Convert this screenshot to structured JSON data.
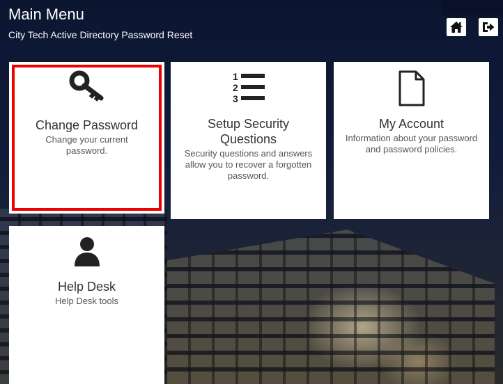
{
  "header": {
    "title": "Main Menu",
    "subtitle": "City Tech Active Directory Password Reset",
    "home_icon": "home-icon",
    "logout_icon": "sign-out-icon"
  },
  "tiles": [
    {
      "title": "Change Password",
      "description": "Change your current password.",
      "icon": "key-icon",
      "selected": true
    },
    {
      "title": "Setup Security Questions",
      "description": "Security questions and answers allow you to recover a forgotten password.",
      "icon": "numbered-list-icon"
    },
    {
      "title": "My Account",
      "description": "Information about your password and password policies.",
      "icon": "document-icon"
    },
    {
      "title": "Help Desk",
      "description": "Help Desk tools",
      "icon": "user-icon"
    }
  ],
  "colors": {
    "selection_outline": "#e00000",
    "tile_background": "#ffffff"
  }
}
